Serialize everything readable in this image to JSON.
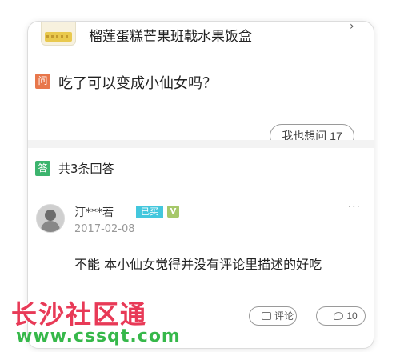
{
  "product": {
    "name": "榴莲蛋糕芒果班戟水果饭盒",
    "arrow": "›"
  },
  "question": {
    "tag": "问",
    "text": "吃了可以变成小仙女吗？",
    "want_button": "我也想问 17"
  },
  "answers": {
    "tag": "答",
    "count_label": "共3条回答",
    "items": [
      {
        "username": "汀***若",
        "badge": "已买",
        "verify_mark": "V",
        "date": "2017-02-08",
        "text": "不能 本小仙女觉得并没有评论里描述的好吃",
        "comment_label": "评论",
        "reply_count": "10",
        "more": "···"
      }
    ]
  },
  "watermark": {
    "title": "长沙社区通",
    "url": "www.cssqt.com",
    "title_color": "#e83a57",
    "url_color": "#36b84a"
  }
}
